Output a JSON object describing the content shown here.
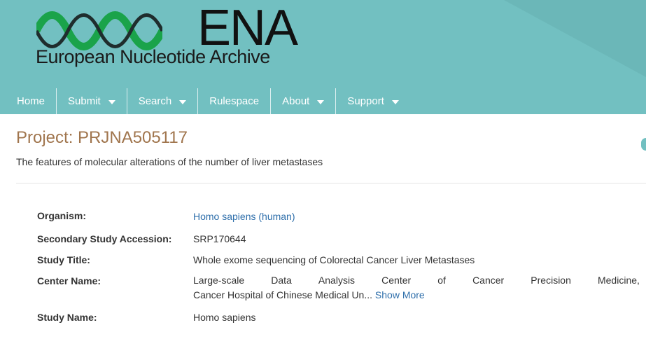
{
  "header": {
    "logo_acronym": "ENA",
    "logo_name": "European Nucleotide Archive",
    "colors": {
      "banner": "#72c0c1",
      "wave_green": "#1aa34a",
      "wave_dark": "#1f2d2d"
    }
  },
  "nav": {
    "items": [
      {
        "label": "Home",
        "has_dropdown": false
      },
      {
        "label": "Submit",
        "has_dropdown": true
      },
      {
        "label": "Search",
        "has_dropdown": true
      },
      {
        "label": "Rulespace",
        "has_dropdown": false
      },
      {
        "label": "About",
        "has_dropdown": true
      },
      {
        "label": "Support",
        "has_dropdown": true
      }
    ]
  },
  "project": {
    "title": "Project: PRJNA505117",
    "description": "The features of molecular alterations of the number of liver metastases"
  },
  "fields": {
    "organism": {
      "label": "Organism:",
      "value": "Homo sapiens (human)"
    },
    "secondary_accession": {
      "label": "Secondary Study Accession:",
      "value": "SRP170644"
    },
    "study_title": {
      "label": "Study Title:",
      "value": "Whole exome sequencing of Colorectal Cancer Liver Metastases"
    },
    "center_name": {
      "label": "Center Name:",
      "line1_words": [
        "Large-scale",
        "Data",
        "Analysis",
        "Center",
        "of",
        "Cancer",
        "Precision",
        "Medicine,"
      ],
      "line2": "Cancer Hospital of Chinese Medical Un...",
      "show_more": "Show More"
    },
    "study_name": {
      "label": "Study Name:",
      "value": "Homo sapiens"
    }
  }
}
